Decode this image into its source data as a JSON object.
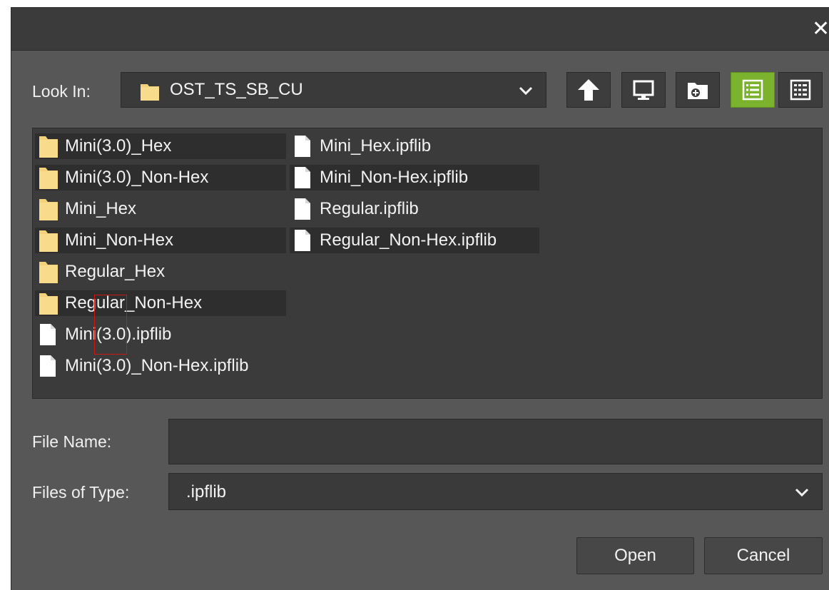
{
  "dialog": {
    "close_glyph": "✕"
  },
  "look_in": {
    "label": "Look In:",
    "value": "OST_TS_SB_CU"
  },
  "toolbar": {
    "icons": [
      "up-arrow-icon",
      "desktop-icon",
      "new-folder-icon",
      "list-view-icon",
      "details-view-icon"
    ],
    "active_color": "#7bb32e"
  },
  "files": {
    "col1": [
      {
        "name": "Mini(3.0)_Hex",
        "type": "folder"
      },
      {
        "name": "Mini(3.0)_Non-Hex",
        "type": "folder"
      },
      {
        "name": "Mini_Hex",
        "type": "folder"
      },
      {
        "name": "Mini_Non-Hex",
        "type": "folder"
      },
      {
        "name": "Regular_Hex",
        "type": "folder"
      },
      {
        "name": "Regular_Non-Hex",
        "type": "folder"
      },
      {
        "name": "Mini(3.0).ipflib",
        "type": "file"
      },
      {
        "name": "Mini(3.0)_Non-Hex.ipflib",
        "type": "file"
      }
    ],
    "col2": [
      {
        "name": "Mini_Hex.ipflib",
        "type": "file"
      },
      {
        "name": "Mini_Non-Hex.ipflib",
        "type": "file"
      },
      {
        "name": "Regular.ipflib",
        "type": "file"
      },
      {
        "name": "Regular_Non-Hex.ipflib",
        "type": "file"
      }
    ]
  },
  "file_name": {
    "label": "File Name:",
    "value": ""
  },
  "file_type": {
    "label": "Files of Type:",
    "value": ".ipflib"
  },
  "buttons": {
    "open": "Open",
    "cancel": "Cancel"
  }
}
